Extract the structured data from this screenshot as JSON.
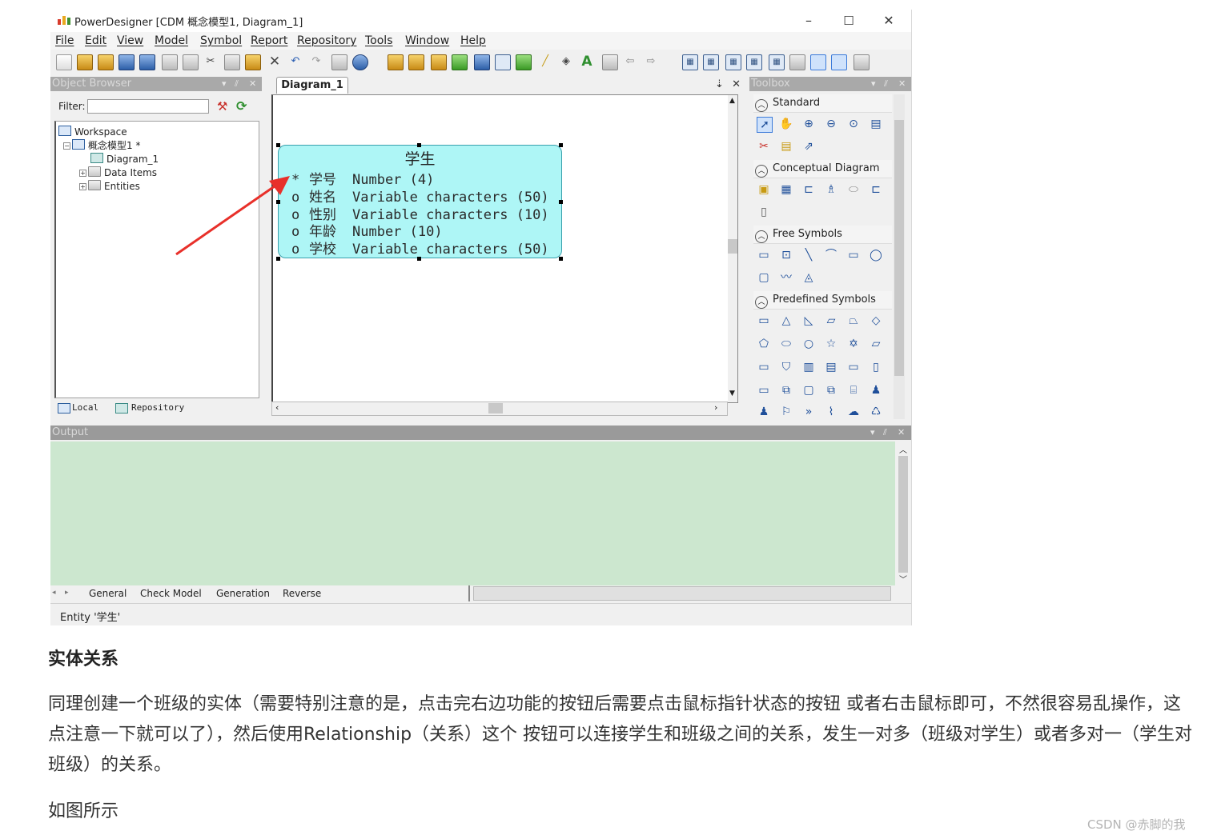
{
  "window": {
    "title": "PowerDesigner [CDM 概念模型1, Diagram_1]",
    "controls": {
      "minimize": "–",
      "maximize": "☐",
      "close": "✕"
    }
  },
  "menu": [
    "File",
    "Edit",
    "View",
    "Model",
    "Symbol",
    "Report",
    "Repository",
    "Tools",
    "Window",
    "Help"
  ],
  "object_browser": {
    "title": "Object Browser",
    "filter_label": "Filter:",
    "filter_value": "",
    "tree": [
      {
        "label": "Workspace",
        "icon": "workspace-icon",
        "level": 0
      },
      {
        "label": "概念模型1 *",
        "icon": "model-icon",
        "level": 1,
        "expander": "−"
      },
      {
        "label": "Diagram_1",
        "icon": "diagram-icon",
        "level": 2
      },
      {
        "label": "Data Items",
        "icon": "folder-icon",
        "level": 2,
        "expander": "+"
      },
      {
        "label": "Entities",
        "icon": "folder-icon",
        "level": 2,
        "expander": "+"
      }
    ],
    "tabs": [
      "Local",
      "Repository"
    ]
  },
  "diagram": {
    "tab": "Diagram_1",
    "entity": {
      "name": "学生",
      "attributes": [
        {
          "mark": "*",
          "name": "学号",
          "type": "Number (4)"
        },
        {
          "mark": "o",
          "name": "姓名",
          "type": "Variable characters (50)"
        },
        {
          "mark": "o",
          "name": "性别",
          "type": "Variable characters (10)"
        },
        {
          "mark": "o",
          "name": "年龄",
          "type": "Number (10)"
        },
        {
          "mark": "o",
          "name": "学校",
          "type": "Variable characters (50)"
        }
      ]
    },
    "annotation_arrow_color": "#e8302a"
  },
  "toolbox": {
    "title": "Toolbox",
    "sections": [
      "Standard",
      "Conceptual Diagram",
      "Free Symbols",
      "Predefined Symbols"
    ]
  },
  "output": {
    "title": "Output",
    "tabs": [
      "General",
      "Check Model",
      "Generation",
      "Reverse"
    ],
    "background": "#cce7cf"
  },
  "statusbar": {
    "text": "Entity '学生'"
  },
  "article": {
    "heading": "实体关系",
    "paragraph": "同理创建一个班级的实体（需要特别注意的是，点击完右边功能的按钮后需要点击鼠标指针状态的按钮 或者右击鼠标即可，不然很容易乱操作，这点注意一下就可以了），然后使用Relationship（关系）这个 按钮可以连接学生和班级之间的关系，发生一对多（班级对学生）或者多对一（学生对班级）的关系。",
    "note": "如图所示"
  },
  "watermark": "CSDN @赤脚的我"
}
